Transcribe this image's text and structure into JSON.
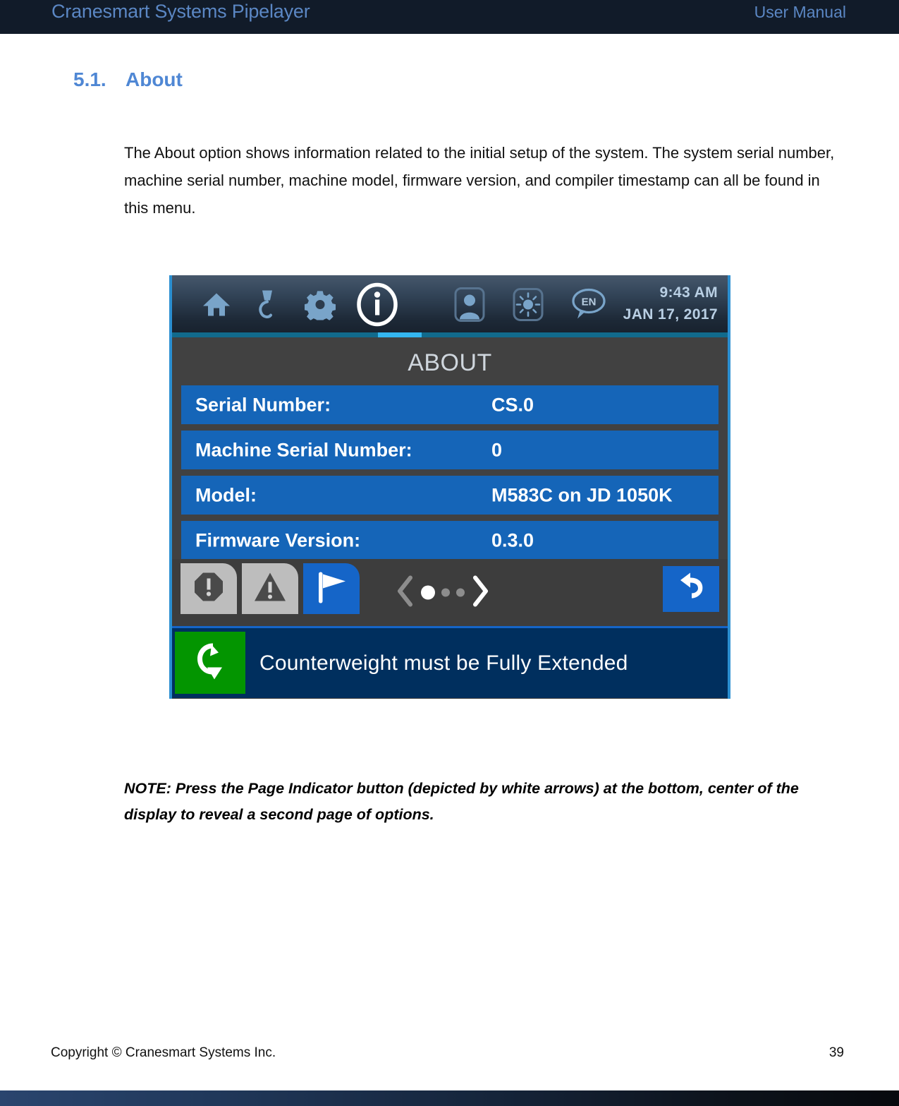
{
  "header": {
    "title": "Cranesmart Systems Pipelayer",
    "manual_label": "User Manual"
  },
  "section": {
    "number": "5.1.",
    "title": "About"
  },
  "body_paragraph": "The About option shows information related to the initial setup of the system.  The system serial number, machine serial number, machine model, firmware version, and compiler timestamp can all be found in this menu.",
  "note_paragraph": "NOTE: Press the Page Indicator button (depicted by white arrows) at the bottom, center of the display to reveal a second page of options.",
  "device_screen": {
    "toolbar": {
      "icons": [
        {
          "name": "home-icon",
          "state": "normal"
        },
        {
          "name": "crane-hook-icon",
          "state": "normal"
        },
        {
          "name": "gear-icon",
          "state": "normal"
        },
        {
          "name": "info-icon",
          "state": "active"
        },
        {
          "name": "user-icon",
          "state": "normal"
        },
        {
          "name": "brightness-icon",
          "state": "normal"
        },
        {
          "name": "language-icon",
          "state": "normal"
        }
      ],
      "language_label": "EN",
      "time": "9:43 AM",
      "date": "JAN 17, 2017",
      "active_icon": "info-icon",
      "accent_color": "#34b6f0",
      "underline_color": "#116a8c"
    },
    "screen_title": "ABOUT",
    "rows": [
      {
        "label": "Serial Number:",
        "value": "CS.0"
      },
      {
        "label": "Machine Serial Number:",
        "value": "0"
      },
      {
        "label": "Model:",
        "value": "M583C on JD 1050K"
      },
      {
        "label": "Firmware Version:",
        "value": "0.3.0"
      }
    ],
    "row_color": "#1565b8",
    "button_bar": {
      "tabs": [
        {
          "name": "alarm-tab",
          "icon": "octagon-exclamation-icon",
          "active": false
        },
        {
          "name": "warning-tab",
          "icon": "triangle-exclamation-icon",
          "active": false
        },
        {
          "name": "flag-tab",
          "icon": "flag-icon",
          "active": true
        }
      ],
      "page_indicator": {
        "prev_enabled": false,
        "next_enabled": true,
        "pages": 3,
        "current_page": 1
      },
      "back_button": {
        "name": "back-button",
        "icon": "back-arrow-icon"
      }
    },
    "status_bar": {
      "badge_icon": "swing-arrow-icon",
      "badge_color": "#039500",
      "message": "Counterweight must be Fully Extended",
      "background_color": "#002f5e"
    }
  },
  "footer": {
    "copyright": "Copyright © Cranesmart Systems Inc.",
    "page_number": "39"
  }
}
